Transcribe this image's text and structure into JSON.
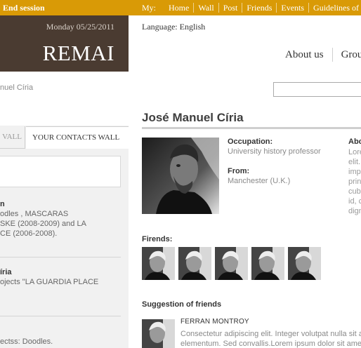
{
  "topbar": {
    "end_session": "End session",
    "my_label": "My:",
    "nav": [
      "Home",
      "Wall",
      "Post",
      "Friends",
      "Events",
      "Guidelines of"
    ]
  },
  "brand": {
    "date": "Monday 05/25/2011",
    "logo": "REMAI"
  },
  "left": {
    "breadcrumb": "nuel Círia",
    "tab_mine": "VALL",
    "tab_contacts": "YOUR CONTACTS WALL",
    "posts": [
      {
        "author": "n",
        "lines": [
          "odles , MASCARAS",
          "SKE (2008-2009) and LA",
          "CE (2006-2008)."
        ]
      },
      {
        "author": "íria",
        "lines": [
          "ojects \"LA GUARDIA PLACE"
        ]
      },
      {
        "author": "",
        "lines": [
          "ectss: Doodles."
        ]
      }
    ]
  },
  "header": {
    "language": "Language: English",
    "nav": [
      "About us",
      "Grou"
    ]
  },
  "profile": {
    "name": "José Manuel Círia",
    "occupation_label": "Occupation:",
    "occupation_value": "University history professor",
    "from_label": "From:",
    "from_value": "Manchester (U.K.)",
    "about_label": "Abo",
    "about_lines": [
      "Lore",
      "elit.",
      "imp",
      "prin",
      "cub",
      "id, c",
      "dign"
    ]
  },
  "friends": {
    "title": "Firends:",
    "count": 5
  },
  "suggestions": {
    "title": "Suggestion of friends",
    "name": "FERRAN MONTROY",
    "text_lines": [
      "Consectetur adipiscing elit. Integer volutpat nulla sit a",
      "elementum. Sed convallis.Lorem ipsum dolor sit ame"
    ]
  },
  "colors": {
    "topbar": "#d99a06",
    "brand_bg": "#4a3b31"
  }
}
